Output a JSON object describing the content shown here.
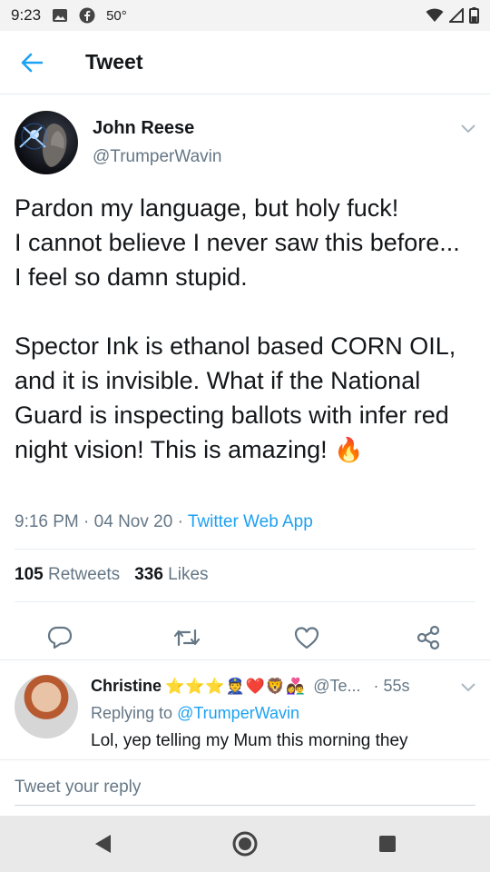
{
  "status_bar": {
    "time": "9:23",
    "temperature": "50°",
    "icons": [
      "photo-icon",
      "facebook-icon",
      "wifi-icon",
      "signal-icon",
      "battery-icon"
    ]
  },
  "header": {
    "title": "Tweet",
    "back_icon": "back-arrow-icon"
  },
  "tweet": {
    "author_name": "John Reese",
    "author_handle": "@TrumperWavin",
    "text": "Pardon my language, but holy fuck!\nI cannot believe I never saw this before... I feel so damn stupid.\n\nSpector Ink is ethanol based CORN OIL, and it is invisible. What if the National Guard is inspecting ballots with infer red night vision! This is amazing!",
    "emoji": "🔥",
    "time": "9:16 PM",
    "date": "04 Nov 20",
    "source": "Twitter Web App",
    "separator": "·",
    "retweets_count": "105",
    "retweets_label": "Retweets",
    "likes_count": "336",
    "likes_label": "Likes",
    "actions": [
      "reply-icon",
      "retweet-icon",
      "like-icon",
      "share-icon"
    ]
  },
  "reply": {
    "name": "Christine",
    "emojis": "⭐⭐⭐👮❤️🦁👩‍❤️‍👨",
    "handle": "@Te...",
    "separator": "·",
    "time": "55s",
    "replying_prefix": "Replying to",
    "replying_to": "@TrumperWavin",
    "text": "Lol, yep telling my Mum this morning they"
  },
  "compose": {
    "placeholder": "Tweet your reply"
  },
  "colors": {
    "accent": "#1da1f2",
    "text": "#14171a",
    "muted": "#657786"
  }
}
